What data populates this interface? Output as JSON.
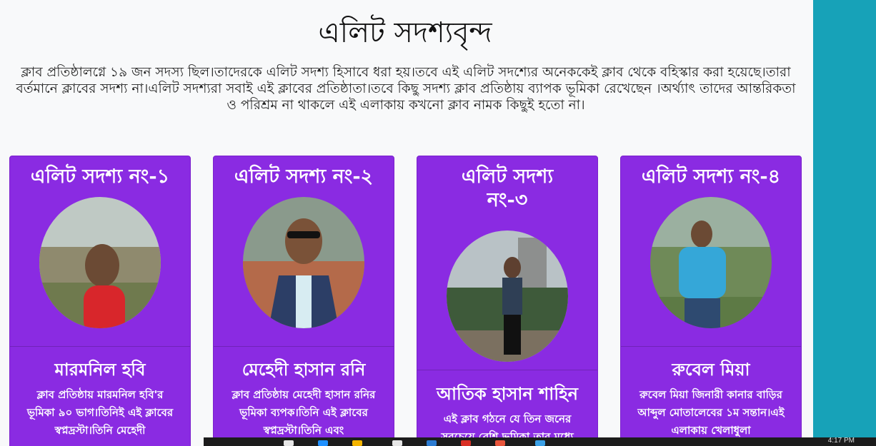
{
  "heading": "এলিট সদশ্যবৃন্দ",
  "intro": "ক্লাব প্রতিষ্ঠালগ্নে ১৯ জন সদস্য ছিল।তাদেরকে এলিট সদশ্য হিসাবে ধরা হয়।তবে এই এলিট সদশ্যের অনেককেই ক্লাব থেকে বহিস্কার করা হয়েছে।তারা বর্তমানে ক্লাবের সদশ্য না।এলিট সদশ্যরা সবাই এই ক্লাবের প্রতিষ্ঠাতা।তবে কিছু সদশ্য ক্লাব প্রতিষ্ঠায় ব্যাপক ভূমিকা রেখেছেন ।অর্থ্যাৎ তাদের আন্তরিকতা ও পরিশ্রম না থাকলে এই এলাকায় কখনো ক্লাব নামক কিছুই হতো না।",
  "cards": [
    {
      "title": "এলিট সদশ্য নং-১",
      "name": "মারমনিল হবি",
      "desc": "ক্লাব প্রতিষ্ঠায় মারমনিল হবি'র ভূমিকা ৯০ ভাগ।তিনিই এই ক্লাবের স্বপ্নদ্রস্টা।তিনি মেহেদী"
    },
    {
      "title": "এলিট সদশ্য নং-২",
      "name": "মেহেদী হাসান রনি",
      "desc": "ক্লাব প্রতিষ্ঠায় মেহেদী হাসান রনির ভূমিকা ব্যপক।তিনি এই ক্লাবের স্বপ্নদ্রস্টা।তিনি এবং"
    },
    {
      "title": "এলিট সদশ্য নং-৩",
      "name": "আতিক হাসান শাহিন",
      "desc": "এই ক্লাব গঠনে যে তিন জনের সবচেয়ে বেশি ভূমিকা তার মধ্যে"
    },
    {
      "title": "এলিট সদশ্য নং-৪",
      "name": "রুবেল মিয়া",
      "desc": "রুবেল মিয়া জিনারী কানার বাড়ির আব্দুল মোতালেবের ১ম সন্তান।এই এলাকায় খেলাধুলা"
    }
  ],
  "colors": {
    "card_bg": "#8a2be2",
    "side_strip": "#17a2b8",
    "page_bg": "#f8f9fa"
  },
  "taskbar": {
    "clock": "4:17 PM"
  }
}
